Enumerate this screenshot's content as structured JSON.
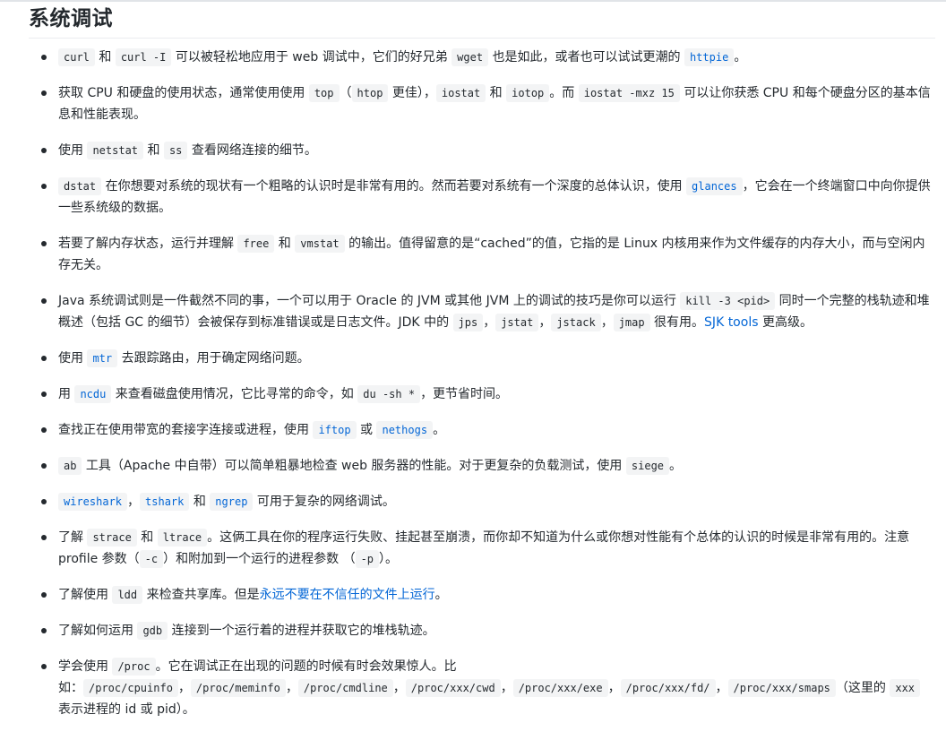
{
  "heading": "系统调试",
  "items": [
    {
      "parts": [
        {
          "t": "code",
          "v": "curl"
        },
        {
          "t": "text",
          "v": " 和 "
        },
        {
          "t": "code",
          "v": "curl -I"
        },
        {
          "t": "text",
          "v": " 可以被轻松地应用于 web 调试中，它们的好兄弟 "
        },
        {
          "t": "code",
          "v": "wget"
        },
        {
          "t": "text",
          "v": " 也是如此，或者也可以试试更潮的 "
        },
        {
          "t": "codelink",
          "v": "httpie"
        },
        {
          "t": "text",
          "v": "。"
        }
      ]
    },
    {
      "parts": [
        {
          "t": "text",
          "v": "获取 CPU 和硬盘的使用状态，通常使用使用 "
        },
        {
          "t": "code",
          "v": "top"
        },
        {
          "t": "text",
          "v": "（"
        },
        {
          "t": "code",
          "v": "htop"
        },
        {
          "t": "text",
          "v": " 更佳），"
        },
        {
          "t": "code",
          "v": "iostat"
        },
        {
          "t": "text",
          "v": " 和 "
        },
        {
          "t": "code",
          "v": "iotop"
        },
        {
          "t": "text",
          "v": "。而 "
        },
        {
          "t": "code",
          "v": "iostat -mxz 15"
        },
        {
          "t": "text",
          "v": " 可以让你获悉 CPU 和每个硬盘分区的基本信息和性能表现。"
        }
      ]
    },
    {
      "parts": [
        {
          "t": "text",
          "v": "使用 "
        },
        {
          "t": "code",
          "v": "netstat"
        },
        {
          "t": "text",
          "v": " 和 "
        },
        {
          "t": "code",
          "v": "ss"
        },
        {
          "t": "text",
          "v": " 查看网络连接的细节。"
        }
      ]
    },
    {
      "parts": [
        {
          "t": "code",
          "v": "dstat"
        },
        {
          "t": "text",
          "v": " 在你想要对系统的现状有一个粗略的认识时是非常有用的。然而若要对系统有一个深度的总体认识，使用 "
        },
        {
          "t": "codelink",
          "v": "glances"
        },
        {
          "t": "text",
          "v": "，它会在一个终端窗口中向你提供一些系统级的数据。"
        }
      ]
    },
    {
      "parts": [
        {
          "t": "text",
          "v": "若要了解内存状态，运行并理解 "
        },
        {
          "t": "code",
          "v": "free"
        },
        {
          "t": "text",
          "v": " 和 "
        },
        {
          "t": "code",
          "v": "vmstat"
        },
        {
          "t": "text",
          "v": " 的输出。值得留意的是“cached”的值，它指的是 Linux 内核用来作为文件缓存的内存大小，而与空闲内存无关。"
        }
      ]
    },
    {
      "parts": [
        {
          "t": "text",
          "v": "Java 系统调试则是一件截然不同的事，一个可以用于 Oracle 的 JVM 或其他 JVM 上的调试的技巧是你可以运行 "
        },
        {
          "t": "code",
          "v": "kill -3 <pid>"
        },
        {
          "t": "text",
          "v": " 同时一个完整的栈轨迹和堆概述（包括 GC 的细节）会被保存到标准错误或是日志文件。JDK 中的 "
        },
        {
          "t": "code",
          "v": "jps"
        },
        {
          "t": "text",
          "v": "，"
        },
        {
          "t": "code",
          "v": "jstat"
        },
        {
          "t": "text",
          "v": "，"
        },
        {
          "t": "code",
          "v": "jstack"
        },
        {
          "t": "text",
          "v": "，"
        },
        {
          "t": "code",
          "v": "jmap"
        },
        {
          "t": "text",
          "v": " 很有用。"
        },
        {
          "t": "link",
          "v": "SJK tools"
        },
        {
          "t": "text",
          "v": " 更高级。"
        }
      ]
    },
    {
      "parts": [
        {
          "t": "text",
          "v": "使用 "
        },
        {
          "t": "codelink",
          "v": "mtr"
        },
        {
          "t": "text",
          "v": " 去跟踪路由，用于确定网络问题。"
        }
      ]
    },
    {
      "parts": [
        {
          "t": "text",
          "v": "用 "
        },
        {
          "t": "codelink",
          "v": "ncdu"
        },
        {
          "t": "text",
          "v": " 来查看磁盘使用情况，它比寻常的命令，如 "
        },
        {
          "t": "code",
          "v": "du -sh *"
        },
        {
          "t": "text",
          "v": "，更节省时间。"
        }
      ]
    },
    {
      "parts": [
        {
          "t": "text",
          "v": "查找正在使用带宽的套接字连接或进程，使用 "
        },
        {
          "t": "codelink",
          "v": "iftop"
        },
        {
          "t": "text",
          "v": " 或 "
        },
        {
          "t": "codelink",
          "v": "nethogs"
        },
        {
          "t": "text",
          "v": "。"
        }
      ]
    },
    {
      "parts": [
        {
          "t": "code",
          "v": "ab"
        },
        {
          "t": "text",
          "v": " 工具（Apache 中自带）可以简单粗暴地检查 web 服务器的性能。对于更复杂的负载测试，使用 "
        },
        {
          "t": "code",
          "v": "siege"
        },
        {
          "t": "text",
          "v": "。"
        }
      ]
    },
    {
      "parts": [
        {
          "t": "codelink",
          "v": "wireshark"
        },
        {
          "t": "text",
          "v": "，"
        },
        {
          "t": "codelink",
          "v": "tshark"
        },
        {
          "t": "text",
          "v": " 和 "
        },
        {
          "t": "codelink",
          "v": "ngrep"
        },
        {
          "t": "text",
          "v": " 可用于复杂的网络调试。"
        }
      ]
    },
    {
      "parts": [
        {
          "t": "text",
          "v": "了解 "
        },
        {
          "t": "code",
          "v": "strace"
        },
        {
          "t": "text",
          "v": " 和 "
        },
        {
          "t": "code",
          "v": "ltrace"
        },
        {
          "t": "text",
          "v": "。这俩工具在你的程序运行失败、挂起甚至崩溃，而你却不知道为什么或你想对性能有个总体的认识的时候是非常有用的。注意 profile 参数（"
        },
        {
          "t": "code",
          "v": "-c"
        },
        {
          "t": "text",
          "v": "）和附加到一个运行的进程参数 （"
        },
        {
          "t": "code",
          "v": "-p"
        },
        {
          "t": "text",
          "v": "）。"
        }
      ]
    },
    {
      "parts": [
        {
          "t": "text",
          "v": "了解使用 "
        },
        {
          "t": "code",
          "v": "ldd"
        },
        {
          "t": "text",
          "v": " 来检查共享库。但是"
        },
        {
          "t": "link",
          "v": "永远不要在不信任的文件上运行"
        },
        {
          "t": "text",
          "v": "。"
        }
      ]
    },
    {
      "parts": [
        {
          "t": "text",
          "v": "了解如何运用 "
        },
        {
          "t": "code",
          "v": "gdb"
        },
        {
          "t": "text",
          "v": " 连接到一个运行着的进程并获取它的堆栈轨迹。"
        }
      ]
    },
    {
      "parts": [
        {
          "t": "text",
          "v": "学会使用 "
        },
        {
          "t": "code",
          "v": "/proc"
        },
        {
          "t": "text",
          "v": "。它在调试正在出现的问题的时候有时会效果惊人。比如："
        },
        {
          "t": "code",
          "v": "/proc/cpuinfo"
        },
        {
          "t": "text",
          "v": "，"
        },
        {
          "t": "code",
          "v": "/proc/meminfo"
        },
        {
          "t": "text",
          "v": "，"
        },
        {
          "t": "code",
          "v": "/proc/cmdline"
        },
        {
          "t": "text",
          "v": "，"
        },
        {
          "t": "code",
          "v": "/proc/xxx/cwd"
        },
        {
          "t": "text",
          "v": "，"
        },
        {
          "t": "code",
          "v": "/proc/xxx/exe"
        },
        {
          "t": "text",
          "v": "，"
        },
        {
          "t": "code",
          "v": "/proc/xxx/fd/"
        },
        {
          "t": "text",
          "v": "，"
        },
        {
          "t": "code",
          "v": "/proc/xxx/smaps"
        },
        {
          "t": "text",
          "v": "（这里的 "
        },
        {
          "t": "code",
          "v": "xxx"
        },
        {
          "t": "text",
          "v": " 表示进程的 id 或 pid）。"
        }
      ]
    }
  ]
}
